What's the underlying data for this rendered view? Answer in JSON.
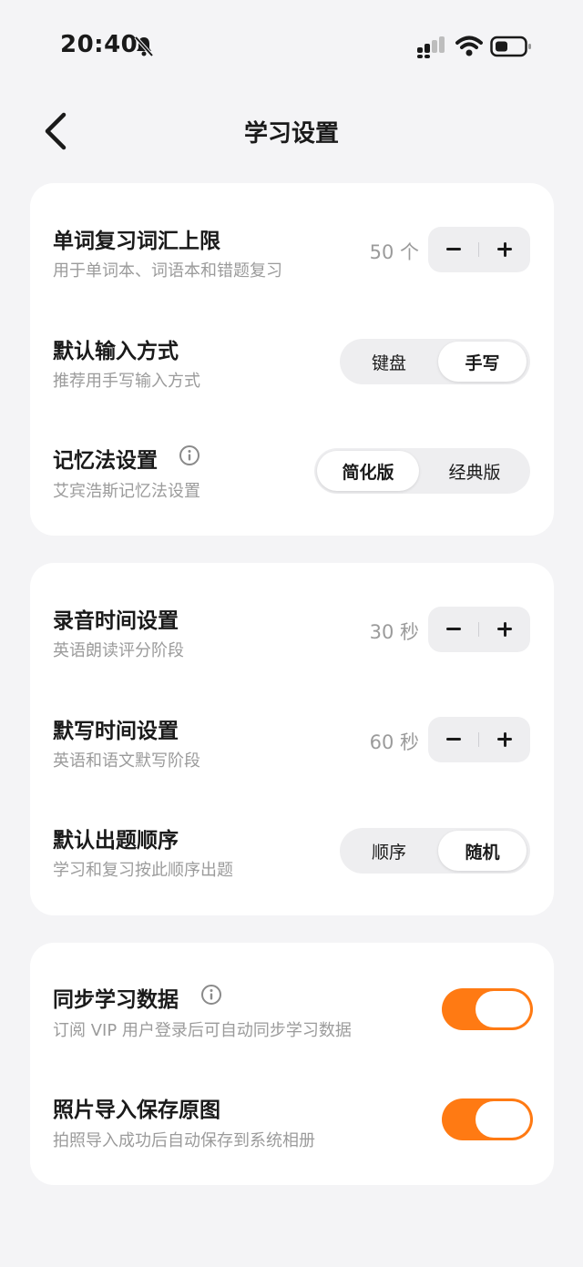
{
  "status_bar": {
    "time": "20:40"
  },
  "header": {
    "title": "学习设置"
  },
  "card1": {
    "word_review": {
      "title": "单词复习词汇上限",
      "subtitle": "用于单词本、词语本和错题复习",
      "value": "50 个"
    },
    "input_method": {
      "title": "默认输入方式",
      "subtitle": "推荐用手写输入方式",
      "options": [
        "键盘",
        "手写"
      ],
      "selected": "手写"
    },
    "memory_method": {
      "title": "记忆法设置",
      "subtitle": "艾宾浩斯记忆法设置",
      "options": [
        "简化版",
        "经典版"
      ],
      "selected": "简化版"
    }
  },
  "card2": {
    "recording_time": {
      "title": "录音时间设置",
      "subtitle": "英语朗读评分阶段",
      "value": "30 秒"
    },
    "dictation_time": {
      "title": "默写时间设置",
      "subtitle": "英语和语文默写阶段",
      "value": "60 秒"
    },
    "question_order": {
      "title": "默认出题顺序",
      "subtitle": "学习和复习按此顺序出题",
      "options": [
        "顺序",
        "随机"
      ],
      "selected": "随机"
    }
  },
  "card3": {
    "sync_data": {
      "title": "同步学习数据",
      "subtitle": "订阅 VIP 用户登录后可自动同步学习数据",
      "enabled": true
    },
    "photo_import": {
      "title": "照片导入保存原图",
      "subtitle": "拍照导入成功后自动保存到系统相册",
      "enabled": true
    }
  },
  "colors": {
    "accent": "#ff7a13",
    "background": "#f4f4f6",
    "card": "#ffffff"
  }
}
